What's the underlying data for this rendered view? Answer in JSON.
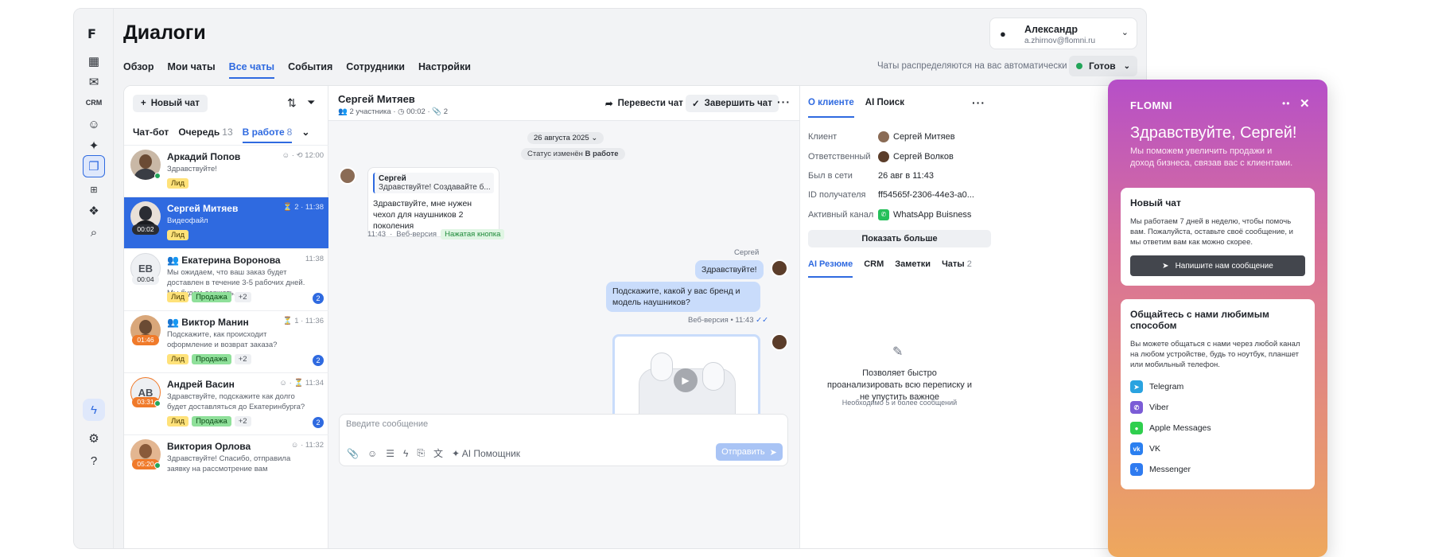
{
  "header": {
    "title": "Диалоги",
    "tabs": [
      {
        "label": "Обзор",
        "active": false
      },
      {
        "label": "Мои чаты",
        "active": false
      },
      {
        "label": "Все чаты",
        "active": true
      },
      {
        "label": "События",
        "active": false
      },
      {
        "label": "Сотрудники",
        "active": false
      },
      {
        "label": "Настройки",
        "active": false
      }
    ],
    "auto_text": "Чаты распределяются на вас автоматически",
    "status": "Готов",
    "user": {
      "name": "Александр",
      "email": "a.zhirnov@flomni.ru"
    }
  },
  "list": {
    "new_chat": "Новый чат",
    "tabs": [
      {
        "label": "Чат-бот",
        "count": ""
      },
      {
        "label": "Очередь",
        "count": "13"
      },
      {
        "label": "В работе",
        "count": "8"
      }
    ],
    "items": [
      {
        "name": "Аркадий Попов",
        "meta": "12:00",
        "preview": "Здравствуйте!",
        "tags": [
          "Лид"
        ],
        "timer": "",
        "initials": "",
        "badge": ""
      },
      {
        "name": "Сергей Митяев",
        "meta": "2 · 11:38",
        "preview": "Видеофайл",
        "tags": [
          "Лид"
        ],
        "timer": "00:02",
        "initials": "",
        "badge": ""
      },
      {
        "name": "Екатерина Воронова",
        "meta": "11:38",
        "preview": "Мы ожидаем, что ваш заказ будет доставлен в течение 3-5 рабочих дней. Мы будем держать...",
        "tags": [
          "Лид",
          "Продажа",
          "+2"
        ],
        "timer": "00:04",
        "initials": "ЕВ",
        "badge": "2"
      },
      {
        "name": "Виктор Манин",
        "meta": "1 · 11:36",
        "preview": "Подскажите, как происходит оформление и возврат заказа?",
        "tags": [
          "Лид",
          "Продажа",
          "+2"
        ],
        "timer": "01:46",
        "initials": "",
        "badge": "2"
      },
      {
        "name": "Андрей Васин",
        "meta": "11:34",
        "preview": "Здравствуйте, подскажите как долго будет доставляться до Екатеринбурга?",
        "tags": [
          "Лид",
          "Продажа",
          "+2"
        ],
        "timer": "03:31",
        "initials": "АВ",
        "badge": "2"
      },
      {
        "name": "Виктория Орлова",
        "meta": "11:32",
        "preview": "Здравствуйте! Спасибо, отправила заявку на рассмотрение вам",
        "tags": [],
        "timer": "05:20",
        "initials": "",
        "badge": ""
      }
    ]
  },
  "chat": {
    "name": "Сергей Митяев",
    "participants": "2 участника",
    "duration": "00:02",
    "attachments": "2",
    "transfer": "Перевести чат",
    "finish": "Завершить чат",
    "date": "26 августа 2025",
    "status_prefix": "Статус изменён",
    "status_value": "В работе",
    "quote_name": "Сергей",
    "quote_text": "Здравствуйте! Создавайте б...",
    "incoming": "Здравствуйте, мне нужен чехол для наушников 2 поколения",
    "in_time": "11:43",
    "in_source": "Веб-версия",
    "in_tag": "Нажатая кнопка",
    "out_name": "Сергей",
    "out1": "Здравствуйте!",
    "out2": "Подскажите, какой у вас бренд и модель наушников?",
    "out_meta": "Веб-версия • 11:43",
    "composer_placeholder": "Введите сообщение",
    "ai_helper": "AI Помощник",
    "send": "Отправить"
  },
  "client": {
    "tabs": [
      "О клиенте",
      "AI Поиск"
    ],
    "rows": [
      {
        "label": "Клиент",
        "value": "Сергей Митяев"
      },
      {
        "label": "Ответственный",
        "value": "Сергей Волков"
      },
      {
        "label": "Был в сети",
        "value": "26 авг в 11:43"
      },
      {
        "label": "ID получателя",
        "value": "ff54565f-2306-44e3-a0..."
      },
      {
        "label": "Активный канал",
        "value": "WhatsApp Buisness"
      }
    ],
    "more": "Показать больше",
    "tabs2": [
      {
        "label": "AI Резюме",
        "count": ""
      },
      {
        "label": "CRM",
        "count": ""
      },
      {
        "label": "Заметки",
        "count": ""
      },
      {
        "label": "Чаты",
        "count": "2"
      }
    ],
    "ai_text": "Позволяет быстро проанализировать всю переписку и не упустить важное",
    "ai_sub": "Необходимо 5 и более сообщений"
  },
  "widget": {
    "logo": "FLOMNI",
    "greeting": "Здравствуйте, Сергей!",
    "subtitle": "Мы поможем увеличить продажи и доход бизнеса, связав вас с клиентами.",
    "card1_title": "Новый чат",
    "card1_text": "Мы работаем 7 дней в неделю, чтобы помочь вам. Пожалуйста, оставьте своё сообщение, и мы ответим вам как можно скорее.",
    "card1_button": "Напишите нам сообщение",
    "card2_title": "Общайтесь с нами любимым способом",
    "card2_text": "Вы можете общаться с нами через любой канал на любом устройстве, будь то ноутбук, планшет или мобильный телефон.",
    "channels": [
      {
        "name": "Telegram",
        "color": "#2aa3e0"
      },
      {
        "name": "Viber",
        "color": "#7b5cd6"
      },
      {
        "name": "Apple Messages",
        "color": "#2fcf4e"
      },
      {
        "name": "VK",
        "color": "#2a7ff0"
      },
      {
        "name": "Messenger",
        "color": "#2f7bf0"
      }
    ]
  }
}
